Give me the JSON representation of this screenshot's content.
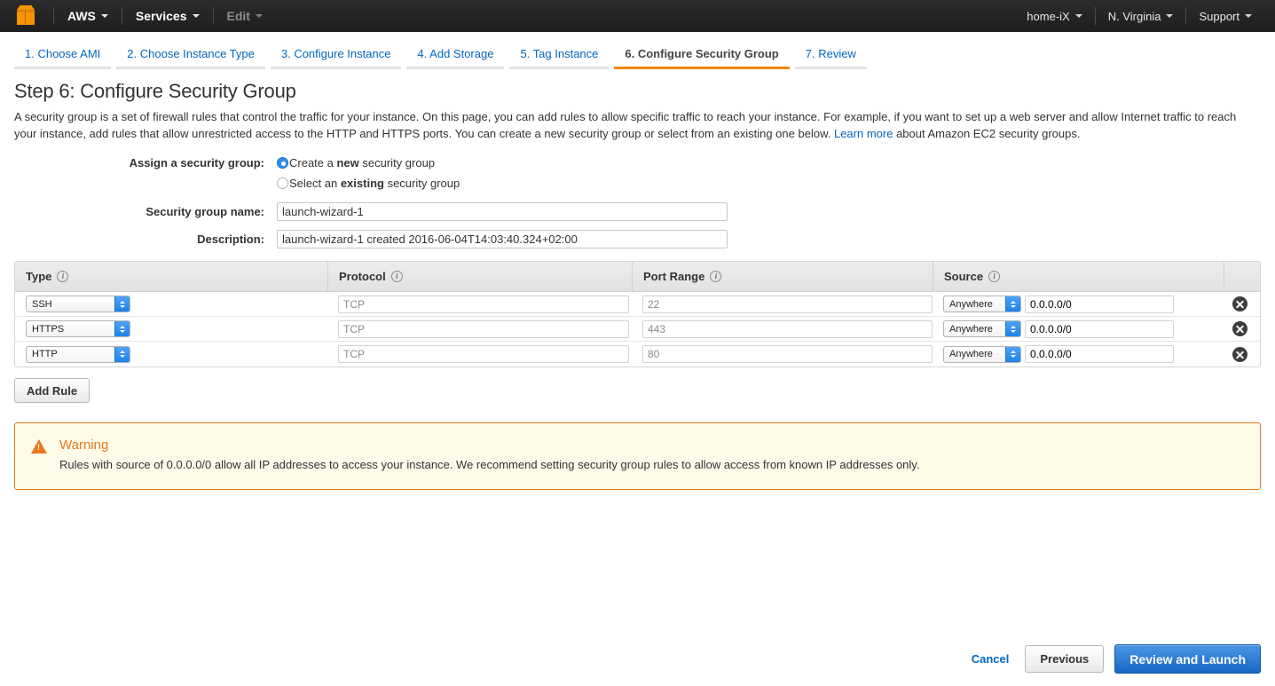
{
  "topnav": {
    "logo_name": "aws-cube-logo",
    "items": [
      {
        "label": "AWS",
        "dim": false
      },
      {
        "label": "Services",
        "dim": false
      },
      {
        "label": "Edit",
        "dim": true
      }
    ],
    "right_items": [
      {
        "label": "home-iX"
      },
      {
        "label": "N. Virginia"
      },
      {
        "label": "Support"
      }
    ]
  },
  "tabs": [
    {
      "label": "1. Choose AMI",
      "active": false
    },
    {
      "label": "2. Choose Instance Type",
      "active": false
    },
    {
      "label": "3. Configure Instance",
      "active": false
    },
    {
      "label": "4. Add Storage",
      "active": false
    },
    {
      "label": "5. Tag Instance",
      "active": false
    },
    {
      "label": "6. Configure Security Group",
      "active": true
    },
    {
      "label": "7. Review",
      "active": false
    }
  ],
  "page": {
    "title": "Step 6: Configure Security Group",
    "intro_part1": "A security group is a set of firewall rules that control the traffic for your instance. On this page, you can add rules to allow specific traffic to reach your instance. For example, if you want to set up a web server and allow Internet traffic to reach your instance, add rules that allow unrestricted access to the HTTP and HTTPS ports. You can create a new security group or select from an existing one below. ",
    "learn_more": "Learn more",
    "intro_part2": " about Amazon EC2 security groups."
  },
  "form": {
    "assign_label": "Assign a security group:",
    "option_new_pre": "Create a ",
    "option_new_strong": "new",
    "option_new_post": " security group",
    "option_existing_pre": "Select an ",
    "option_existing_strong": "existing",
    "option_existing_post": " security group",
    "selected_option": "create-new",
    "name_label": "Security group name:",
    "name_value": "launch-wizard-1",
    "description_label": "Description:",
    "description_value": "launch-wizard-1 created 2016-06-04T14:03:40.324+02:00"
  },
  "rules_table": {
    "columns": [
      {
        "label": "Type",
        "info": true
      },
      {
        "label": "Protocol",
        "info": true
      },
      {
        "label": "Port Range",
        "info": true
      },
      {
        "label": "Source",
        "info": true
      }
    ],
    "rows": [
      {
        "type": "SSH",
        "protocol": "TCP",
        "port": "22",
        "source_select": "Anywhere",
        "cidr": "0.0.0.0/0"
      },
      {
        "type": "HTTPS",
        "protocol": "TCP",
        "port": "443",
        "source_select": "Anywhere",
        "cidr": "0.0.0.0/0"
      },
      {
        "type": "HTTP",
        "protocol": "TCP",
        "port": "80",
        "source_select": "Anywhere",
        "cidr": "0.0.0.0/0"
      }
    ],
    "add_rule_label": "Add Rule"
  },
  "warning": {
    "title": "Warning",
    "body": "Rules with source of 0.0.0.0/0 allow all IP addresses to access your instance. We recommend setting security group rules to allow access from known IP addresses only."
  },
  "footer": {
    "cancel_label": "Cancel",
    "previous_label": "Previous",
    "review_launch_label": "Review and Launch"
  },
  "colors": {
    "aws_orange": "#f0860a",
    "link_blue": "#0066c0",
    "warning_orange": "#e87722",
    "primary_blue": "#1667c4",
    "nav_dark": "#1f1f1f"
  }
}
